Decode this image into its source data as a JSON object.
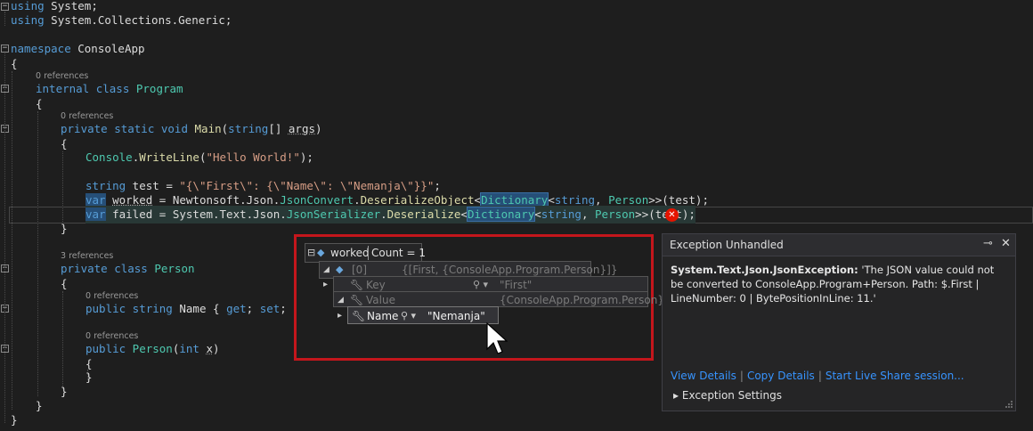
{
  "code": {
    "line1_kw": "using",
    "line1_rest": " System;",
    "line2_kw": "using",
    "line2_rest": " System.Collections.Generic;",
    "ns_kw": "namespace",
    "ns_name": " ConsoleApp",
    "brace_open": "{",
    "brace_close": "}",
    "refs_program": "0 references",
    "class_kw": "internal class",
    "class_name": " Program",
    "refs_main": "0 references",
    "main_kw": "private static void",
    "main_name": " Main",
    "main_open": "(",
    "main_string": "string",
    "main_args_pre": "[] ",
    "main_args": "args",
    "main_close": ")",
    "console_type": "Console",
    "console_dot": ".",
    "console_method": "WriteLine",
    "console_open": "(",
    "console_str": "\"Hello World!\"",
    "console_close": ");",
    "test_kw": "string",
    "test_name": " test",
    "test_eq": " = ",
    "test_str": "\"{\\\"First\\\": {\\\"Name\\\": \\\"Nemanja\\\"}}\"",
    "test_end": ";",
    "w_var": "var",
    "w_name": "worked",
    "w_eq": " = Newtonsoft.Json.",
    "w_type": "JsonConvert",
    "w_dot": ".",
    "w_method": "DeserializeObject",
    "w_lt": "<",
    "w_dict": "Dictionary",
    "w_gt1": "<",
    "w_string": "string",
    "w_comma": ", ",
    "w_person": "Person",
    "w_tail": ">>(test);",
    "f_var": "var",
    "f_name": "failed",
    "f_eq": " = System.Text.Json.",
    "f_type": "JsonSerializer",
    "f_dot": ".",
    "f_method": "Deserialize",
    "f_lt": "<",
    "f_dict": "Dictionary",
    "f_gt1": "<",
    "f_string": "string",
    "f_comma": ", ",
    "f_person": "Person",
    "f_tail": ">>(test);",
    "refs_person": "3 references",
    "pclass_kw": "private class",
    "pclass_name": " Person",
    "refs_name": "0 references",
    "prop_kw": "public string",
    "prop_name": " Name { ",
    "prop_get": "get",
    "prop_semi": "; ",
    "prop_set": "set",
    "prop_end": "; }",
    "refs_ctor": "0 references",
    "ctor_kw": "public",
    "ctor_name": " Person",
    "ctor_open": "(",
    "ctor_int": "int",
    "ctor_x_pre": " ",
    "ctor_x": "x",
    "ctor_close": ")"
  },
  "fold_markers": {
    "collapse": "−"
  },
  "datatip": {
    "root_expander": "⊟",
    "root_name": "worked",
    "root_value": "Count = 1",
    "item0_name": "[0]",
    "item0_value": "{[First, {ConsoleApp.Program.Person}]}",
    "key_name": "Key",
    "key_value": "\"First\"",
    "value_name": "Value",
    "value_value": "{ConsoleApp.Program.Person}",
    "name_name": "Name",
    "name_value": "\"Nemanja\"",
    "expander_down": "◢",
    "expander_right": "▸"
  },
  "exception": {
    "title": "Exception Unhandled",
    "pin_icon": "⊸",
    "close_icon": "✕",
    "type": "System.Text.Json.JsonException:",
    "message": " 'The JSON value could not be converted to ConsoleApp.Program+Person. Path: $.First | LineNumber: 0 | BytePositionInLine: 11.'",
    "link_details": "View Details",
    "link_copy": "Copy Details",
    "link_share": "Start Live Share session...",
    "settings_arrow": "▸",
    "settings_label": "Exception Settings"
  },
  "error_glyph": "✕",
  "colors": {
    "background": "#1e1e1e",
    "keyword": "#569cd6",
    "type": "#4ec9b0",
    "string": "#d69d85",
    "method": "#dcdcaa",
    "highlight": "#264f78",
    "error": "#e51400",
    "link": "#3794ff",
    "frame": "#c4161c"
  }
}
